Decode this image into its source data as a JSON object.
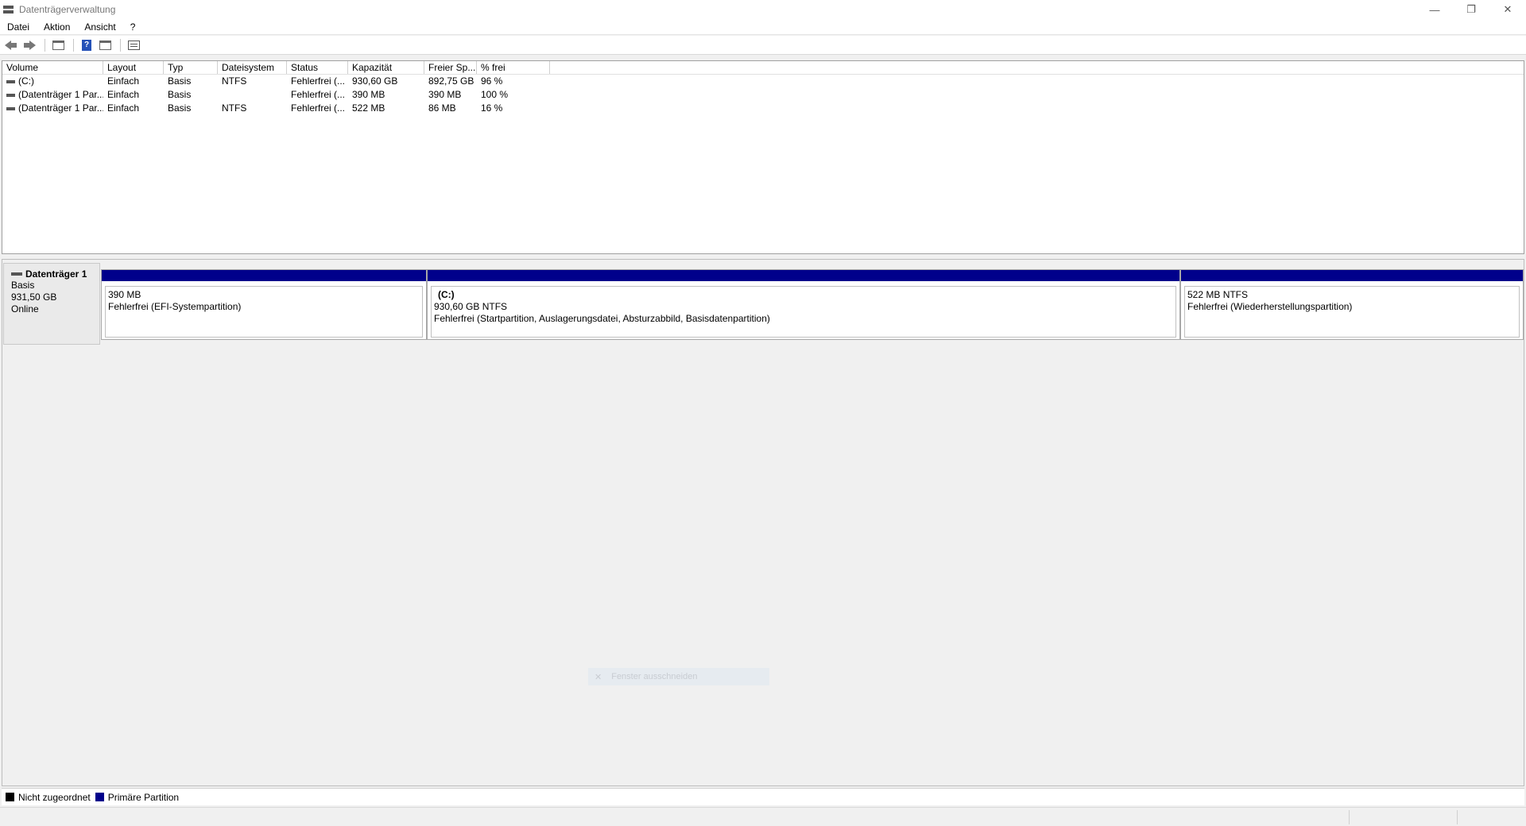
{
  "window": {
    "title": "Datenträgerverwaltung",
    "minimize_icon": "minimize-icon",
    "restore_icon": "restore-icon",
    "close_icon": "close-icon"
  },
  "menu": [
    "Datei",
    "Aktion",
    "Ansicht",
    "?"
  ],
  "toolbar": {
    "icons": [
      "back-arrow-icon",
      "forward-arrow-icon",
      "console-tree-icon",
      "help-icon",
      "properties-icon",
      "view-icon"
    ],
    "help_glyph": "?"
  },
  "volume_list": {
    "columns": [
      "Volume",
      "Layout",
      "Typ",
      "Dateisystem",
      "Status",
      "Kapazität",
      "Freier Sp...",
      "% frei"
    ],
    "rows": [
      [
        "(C:)",
        "Einfach",
        "Basis",
        "NTFS",
        "Fehlerfrei (...",
        "930,60 GB",
        "892,75 GB",
        "96 %"
      ],
      [
        "(Datenträger 1 Par...",
        "Einfach",
        "Basis",
        "",
        "Fehlerfrei (...",
        "390 MB",
        "390 MB",
        "100 %"
      ],
      [
        "(Datenträger 1 Par...",
        "Einfach",
        "Basis",
        "NTFS",
        "Fehlerfrei (...",
        "522 MB",
        "86 MB",
        "16 %"
      ]
    ]
  },
  "disk": {
    "name": "Datenträger 1",
    "type": "Basis",
    "size": "931,50 GB",
    "status": "Online",
    "partitions": [
      {
        "name": "",
        "size": "390 MB",
        "status": "Fehlerfrei (EFI-Systempartition)"
      },
      {
        "name": "(C:)",
        "size": "930,60 GB NTFS",
        "status": "Fehlerfrei (Startpartition, Auslagerungsdatei, Absturzabbild, Basisdatenpartition)"
      },
      {
        "name": "",
        "size": "522 MB NTFS",
        "status": "Fehlerfrei (Wiederherstellungspartition)"
      }
    ]
  },
  "ghost_hint": "Fenster ausschneiden",
  "legend": {
    "items": [
      {
        "label": "Nicht zugeordnet",
        "color": "#000000"
      },
      {
        "label": "Primäre Partition",
        "color": "#00008b"
      }
    ]
  },
  "colors": {
    "partition_bar": "#00008b",
    "unallocated": "#000000"
  }
}
